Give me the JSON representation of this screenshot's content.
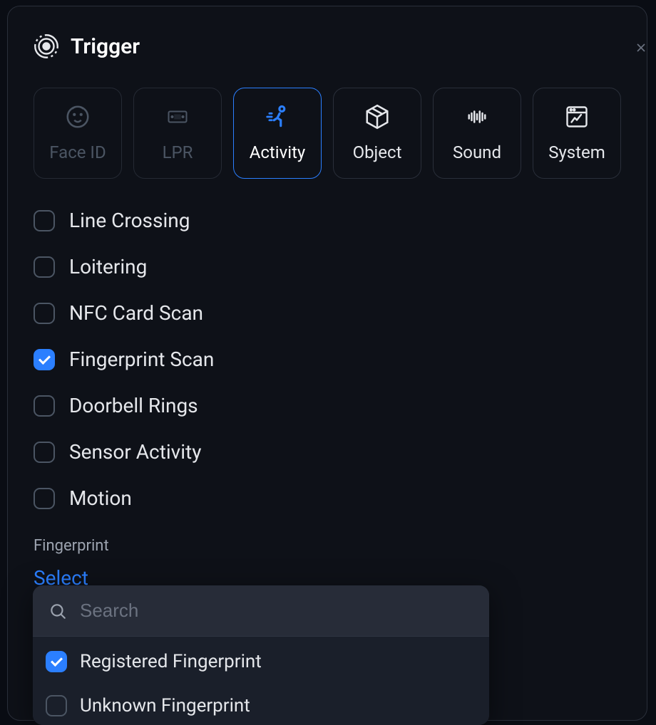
{
  "header": {
    "title": "Trigger"
  },
  "tabs": [
    {
      "label": "Face ID",
      "icon": "face",
      "state": "disabled"
    },
    {
      "label": "LPR",
      "icon": "lpr",
      "state": "disabled"
    },
    {
      "label": "Activity",
      "icon": "activity",
      "state": "active"
    },
    {
      "label": "Object",
      "icon": "object",
      "state": "normal"
    },
    {
      "label": "Sound",
      "icon": "sound",
      "state": "normal"
    },
    {
      "label": "System",
      "icon": "system",
      "state": "normal"
    }
  ],
  "activity_options": [
    {
      "label": "Line Crossing",
      "checked": false
    },
    {
      "label": "Loitering",
      "checked": false
    },
    {
      "label": "NFC Card Scan",
      "checked": false
    },
    {
      "label": "Fingerprint Scan",
      "checked": true
    },
    {
      "label": "Doorbell Rings",
      "checked": false
    },
    {
      "label": "Sensor Activity",
      "checked": false
    },
    {
      "label": "Motion",
      "checked": false
    }
  ],
  "fingerprint": {
    "section_label": "Fingerprint",
    "select_label": "Select",
    "search_placeholder": "Search",
    "options": [
      {
        "label": "Registered Fingerprint",
        "checked": true
      },
      {
        "label": "Unknown Fingerprint",
        "checked": false
      }
    ]
  }
}
